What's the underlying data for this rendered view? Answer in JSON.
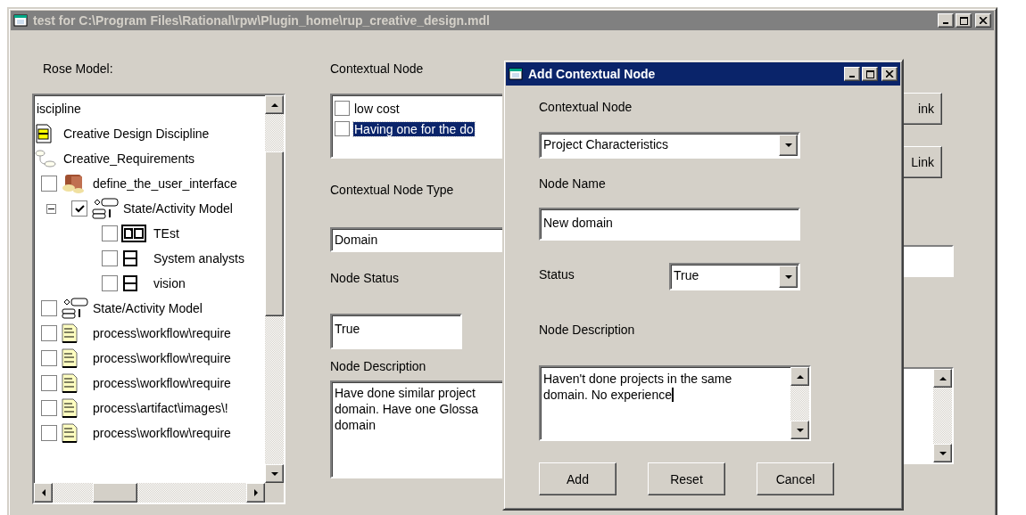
{
  "window": {
    "title": "test for C:\\Program Files\\Rational\\rpw\\Plugin_home\\rup_creative_design.mdl",
    "active": false
  },
  "rose_model": {
    "label": "Rose Model:",
    "tree": [
      {
        "label": "iscipline",
        "kind": "text"
      },
      {
        "label": "Creative Design Discipline",
        "kind": "discipline"
      },
      {
        "label": "Creative_Requirements",
        "kind": "usecase"
      },
      {
        "label": "define_the_user_interface",
        "kind": "activity",
        "checked": false,
        "children": [
          {
            "label": "State/Activity Model",
            "kind": "statechart",
            "checked": true,
            "expanded": true,
            "children": [
              {
                "label": "TEst",
                "kind": "diagram",
                "checked": false
              },
              {
                "label": "System analysts",
                "kind": "class",
                "checked": false
              },
              {
                "label": "vision",
                "kind": "class",
                "checked": false
              }
            ]
          }
        ]
      },
      {
        "label": "State/Activity Model",
        "kind": "statechart",
        "checked": false
      },
      {
        "label": "process\\workflow\\require",
        "kind": "document",
        "checked": false
      },
      {
        "label": "process\\workflow\\require",
        "kind": "document",
        "checked": false
      },
      {
        "label": "process\\workflow\\require",
        "kind": "document",
        "checked": false
      },
      {
        "label": "process\\artifact\\images\\!",
        "kind": "document",
        "checked": false
      },
      {
        "label": "process\\workflow\\require",
        "kind": "document",
        "checked": false
      }
    ]
  },
  "contextual_node": {
    "label": "Contextual Node",
    "items": [
      {
        "label": "low cost",
        "checked": false,
        "selected": false
      },
      {
        "label": "Having one for the do",
        "checked": false,
        "selected": true
      }
    ]
  },
  "contextual_node_type": {
    "label": "Contextual Node Type",
    "value": "Domain"
  },
  "node_status": {
    "label": "Node Status",
    "value": "True"
  },
  "node_description": {
    "label": "Node Description",
    "value": "Have done similar project\ndomain. Have one Glossa\ndomain"
  },
  "right_panel": {
    "buttons": [
      "ink",
      "Link"
    ]
  },
  "dialog": {
    "title": "Add Contextual Node",
    "active": true,
    "contextual_node": {
      "label": "Contextual Node",
      "value": "Project Characteristics"
    },
    "node_name": {
      "label": "Node Name",
      "value": "New domain"
    },
    "status": {
      "label": "Status",
      "value": "True"
    },
    "node_description": {
      "label": "Node Description",
      "value": "Haven't done projects in the same domain. No experience",
      "focused": true
    },
    "buttons": [
      "Add",
      "Reset",
      "Cancel"
    ]
  }
}
